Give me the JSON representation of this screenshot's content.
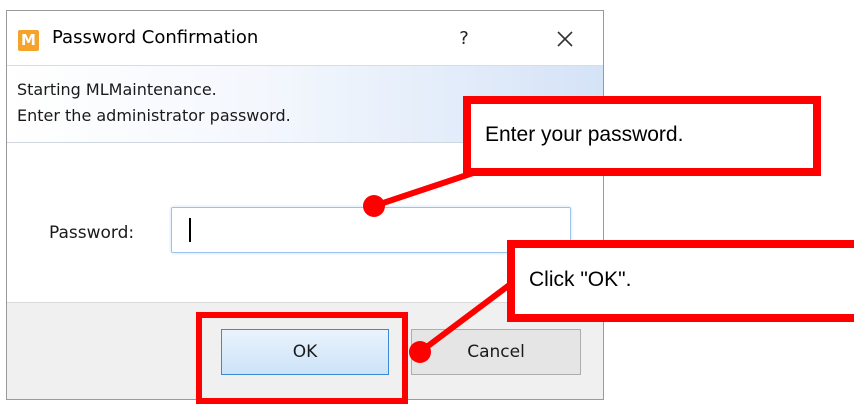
{
  "dialog": {
    "app_icon_letter": "M",
    "title": "Password Confirmation",
    "help_label": "?",
    "banner_line1": "Starting MLMaintenance.",
    "banner_line2": "Enter the administrator password.",
    "password_label": "Password:",
    "password_value": "",
    "ok_label": "OK",
    "cancel_label": "Cancel"
  },
  "annotations": {
    "password_callout": "Enter your password.",
    "ok_callout": "Click \"OK\".",
    "highlight_color": "#ff0000"
  },
  "colors": {
    "app_icon": "#f5a32b",
    "ok_button_border": "#3c8ad6",
    "input_focus_border": "#9ec3e9"
  }
}
